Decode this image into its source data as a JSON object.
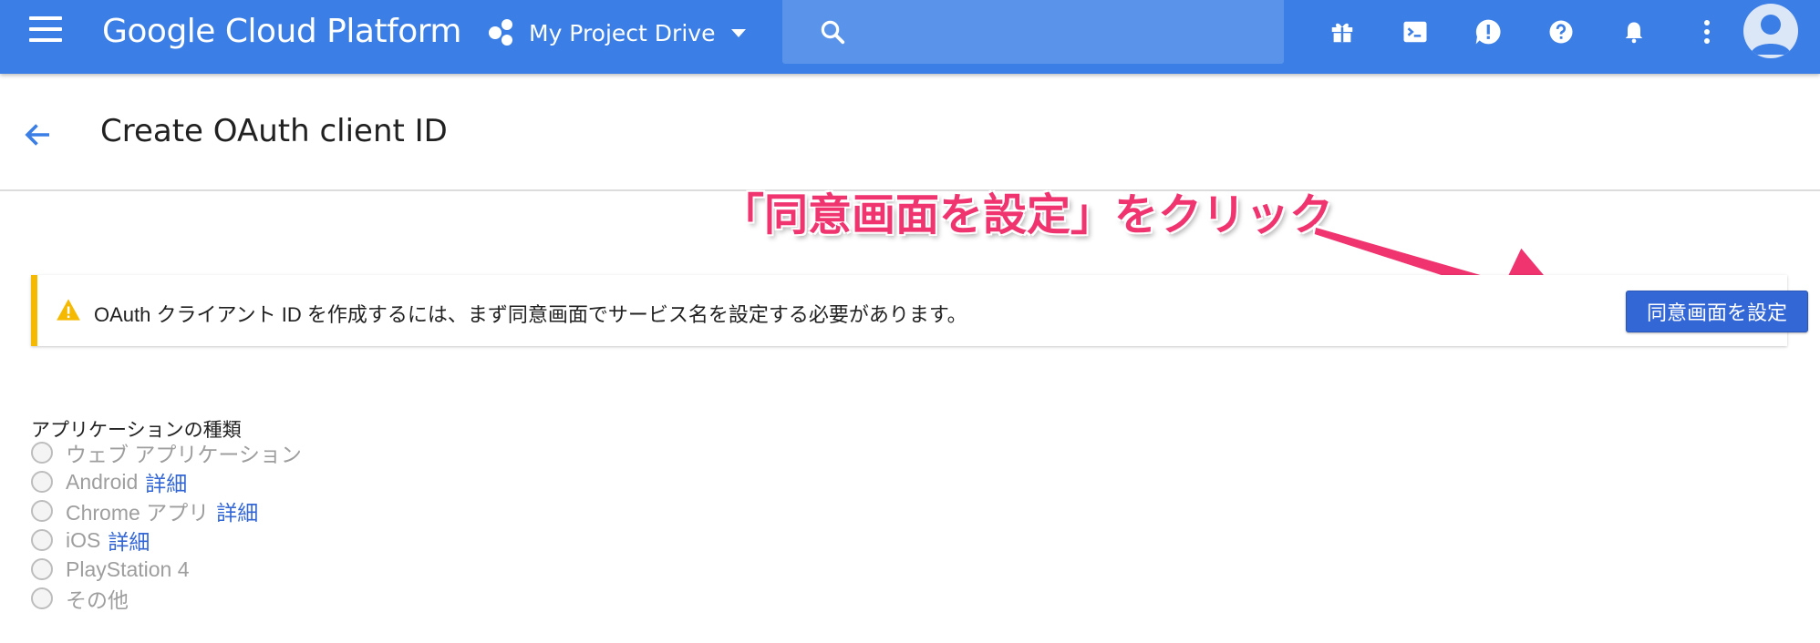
{
  "topbar": {
    "brand": "Google Cloud Platform",
    "project_name": "My Project Drive",
    "background": "#3a7ee6",
    "icons": [
      "gift-icon",
      "terminal-icon",
      "feedback-icon",
      "help-icon",
      "notifications-icon",
      "more-vert-icon",
      "account-avatar"
    ]
  },
  "header": {
    "title": "Create OAuth client ID"
  },
  "annotation": {
    "text": "「同意画面を設定」をクリック",
    "color": "#f0346f"
  },
  "warning": {
    "message": "OAuth クライアント ID を作成するには、まず同意画面でサービス名を設定する必要があります。",
    "button_label": "同意画面を設定",
    "accent": "#f5b900"
  },
  "app_type": {
    "label": "アプリケーションの種類",
    "options": [
      {
        "label": "ウェブ アプリケーション",
        "link": ""
      },
      {
        "label": "Android",
        "link": "詳細"
      },
      {
        "label": "Chrome アプリ",
        "link": "詳細"
      },
      {
        "label": "iOS",
        "link": "詳細"
      },
      {
        "label": "PlayStation 4",
        "link": ""
      },
      {
        "label": "その他",
        "link": ""
      }
    ]
  }
}
